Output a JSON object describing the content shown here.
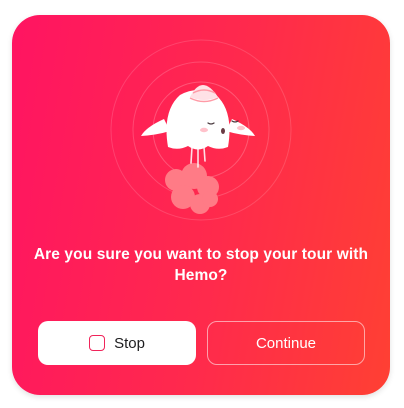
{
  "dialog": {
    "message": "Are you sure you want to stop your tour with Hemo?",
    "illustration_icon": "rocket-ghost-icon",
    "stop_button": {
      "label": "Stop",
      "icon": "checkbox-icon"
    },
    "continue_button": {
      "label": "Continue"
    },
    "colors": {
      "gradient_start": "#ff1462",
      "gradient_end": "#ff4033",
      "button_fill": "#ffffff",
      "checkbox_border": "#f0245a",
      "smoke": "#ff7b86"
    }
  }
}
